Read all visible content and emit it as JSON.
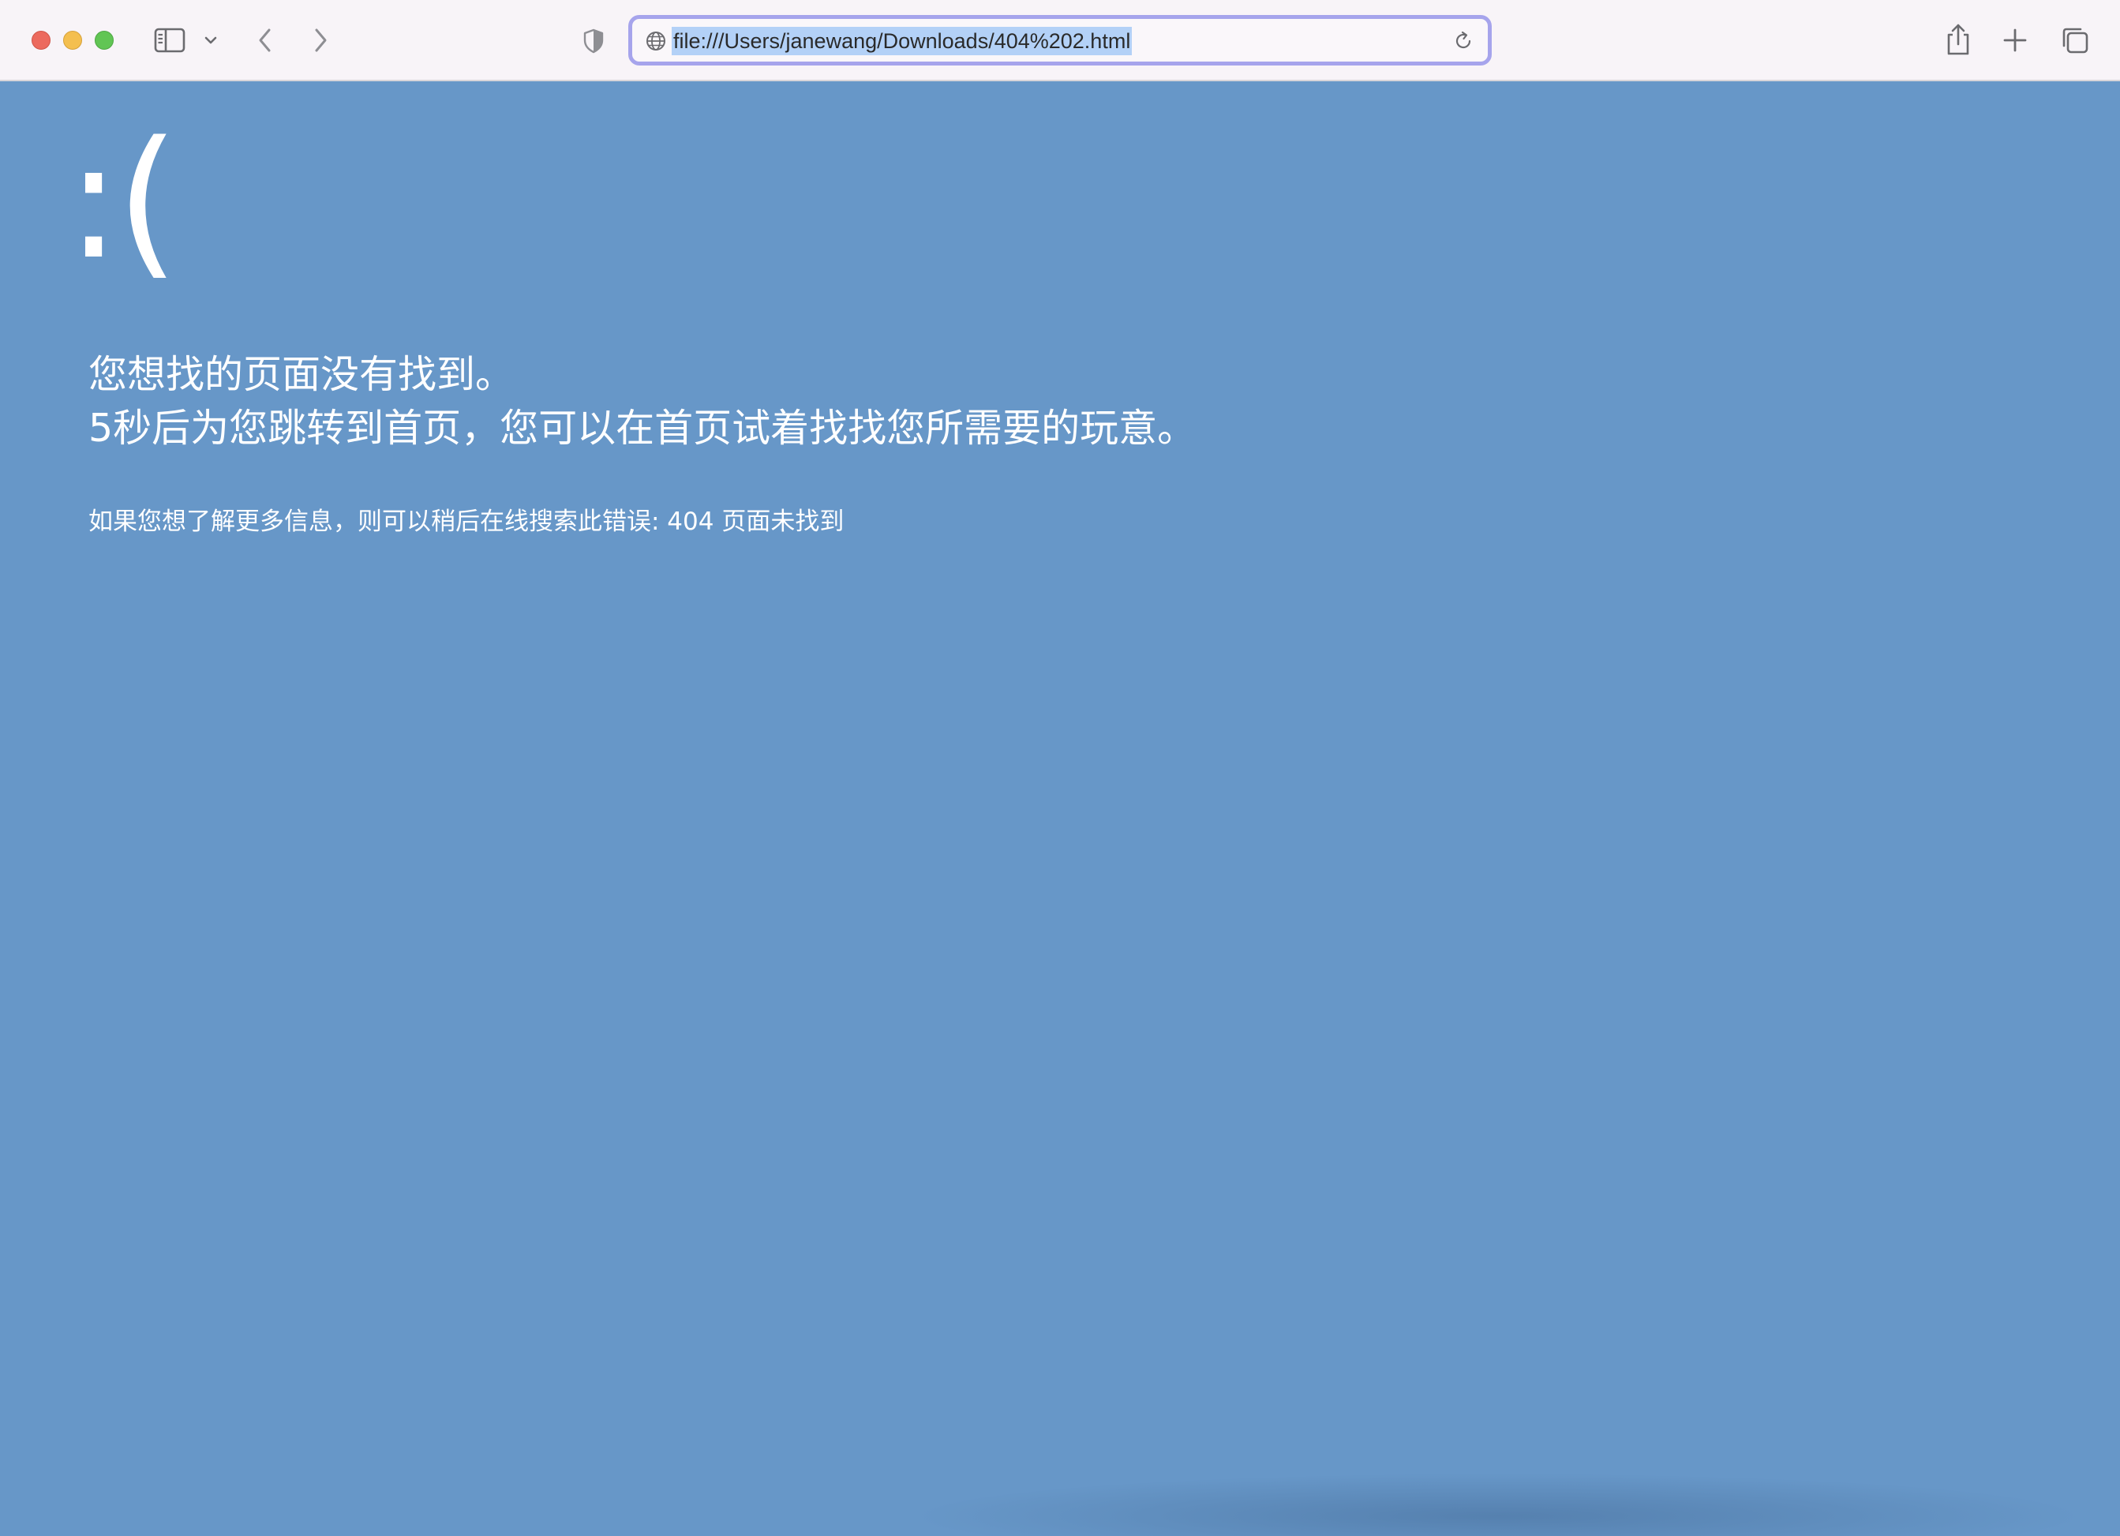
{
  "browser": {
    "address_bar": {
      "url": "file:///Users/janewang/Downloads/404%202.html"
    },
    "icons": {
      "sidebar": "sidebar-icon",
      "sidebar_menu": "chevron-down-icon",
      "back": "chevron-left-icon",
      "forward": "chevron-right-icon",
      "privacy": "shield-icon",
      "site": "globe-icon",
      "reload": "reload-icon",
      "share": "share-icon",
      "new_tab": "plus-icon",
      "tab_overview": "tabs-overview-icon"
    },
    "colors": {
      "address_focus_ring": "#a6a4ec",
      "url_selection": "#b3d1f7",
      "traffic_close": "#ec6a5e",
      "traffic_minimize": "#f4bf4f",
      "traffic_maximize": "#61c554"
    }
  },
  "page": {
    "background_color": "#6797c8",
    "sad_face": ":(",
    "headline_line1": "您想找的页面没有找到。",
    "headline_line2": "5秒后为您跳转到首页，您可以在首页试着找找您所需要的玩意。",
    "info_line": "如果您想了解更多信息，则可以稍后在线搜索此错误: 404 页面未找到"
  }
}
